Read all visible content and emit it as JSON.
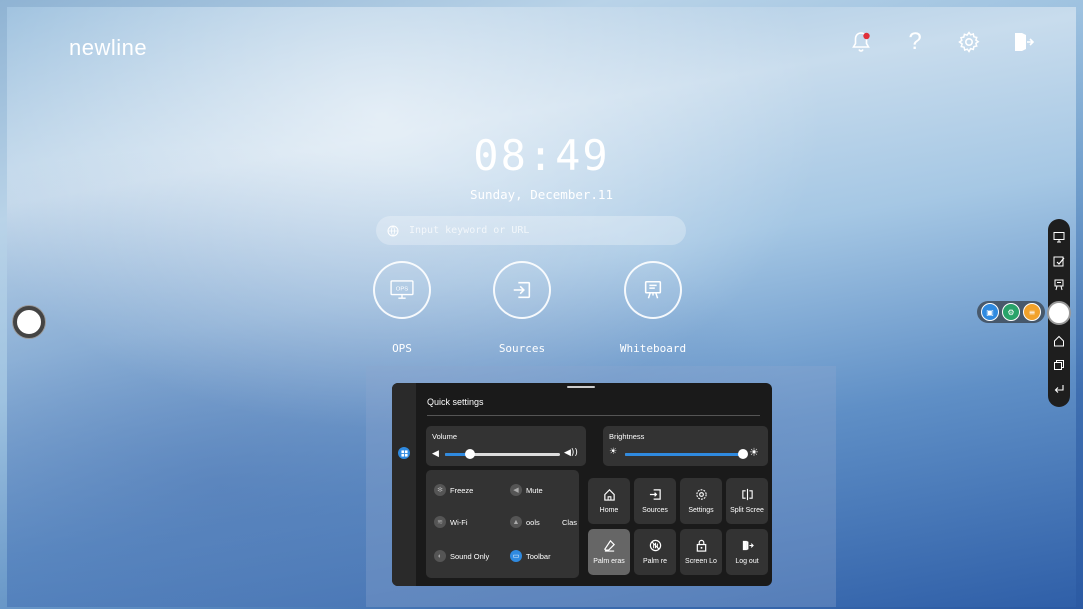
{
  "brand": {
    "logo": "newline"
  },
  "topbar": {
    "icons": [
      "notification-bell-icon",
      "help-icon",
      "settings-gear-icon",
      "exit-door-icon"
    ],
    "help_glyph": "?"
  },
  "clock": {
    "time": "08:49",
    "date": "Sunday, December.11"
  },
  "search": {
    "placeholder": "Input keyword or URL"
  },
  "apps": [
    {
      "label": "OPS",
      "icon": "ops-icon",
      "badge": "OPS"
    },
    {
      "label": "Sources",
      "icon": "sources-icon"
    },
    {
      "label": "Whiteboard",
      "icon": "whiteboard-icon"
    }
  ],
  "quick_settings": {
    "title": "Quick settings",
    "volume": {
      "label": "Volume",
      "level_percent": 22
    },
    "brightness": {
      "label": "Brightness",
      "level_percent": 100
    },
    "toggles": [
      {
        "label": "Freeze",
        "icon": "snowflake-icon",
        "on": false
      },
      {
        "label": "Mute",
        "icon": "mute-icon",
        "on": false
      },
      {
        "label": "Wi-Fi",
        "icon": "wifi-icon",
        "on": false
      },
      {
        "label": "ools",
        "icon": "tools-icon",
        "on": false
      },
      {
        "label": "Clas",
        "icon": "",
        "on": false
      },
      {
        "label": "Sound Only",
        "icon": "ear-icon",
        "on": false
      },
      {
        "label": "Toolbar",
        "icon": "toolbar-icon",
        "on": true
      }
    ],
    "tiles": [
      {
        "label": "Home",
        "icon": "home-icon",
        "active": false
      },
      {
        "label": "Sources",
        "icon": "sources-icon",
        "active": false
      },
      {
        "label": "Settings",
        "icon": "settings-gear-icon",
        "active": false
      },
      {
        "label": "Split Scree",
        "icon": "split-screen-icon",
        "active": false
      },
      {
        "label": "Palm eras",
        "icon": "eraser-icon",
        "active": true
      },
      {
        "label": "Palm re",
        "icon": "palm-reject-icon",
        "active": false
      },
      {
        "label": "Screen Lo",
        "icon": "lock-icon",
        "active": false
      },
      {
        "label": "Log out",
        "icon": "logout-icon",
        "active": false
      }
    ]
  },
  "accent_color": "#2f8ae0"
}
